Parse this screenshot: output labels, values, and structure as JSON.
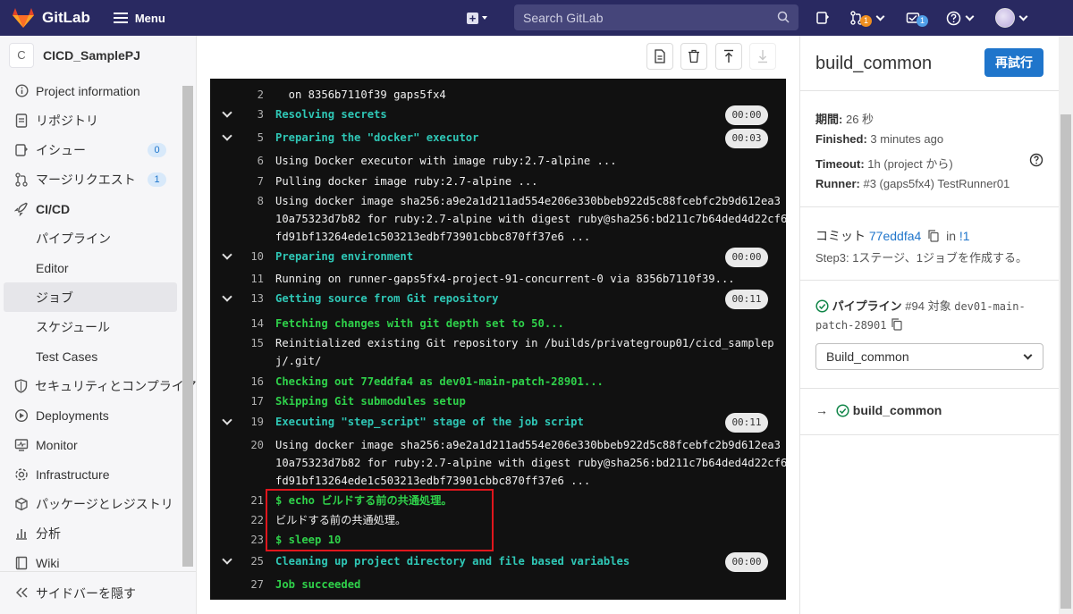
{
  "topbar": {
    "app_name": "GitLab",
    "menu_label": "Menu",
    "search_placeholder": "Search GitLab",
    "mr_count": "1",
    "todo_count": "1"
  },
  "sidebar": {
    "project_initial": "C",
    "project_name": "CICD_SamplePJ",
    "items": [
      {
        "label": "Project information",
        "icon": "info-icon"
      },
      {
        "label": "リポジトリ",
        "icon": "document-icon"
      },
      {
        "label": "イシュー",
        "icon": "issues-icon",
        "count": "0"
      },
      {
        "label": "マージリクエスト",
        "icon": "merge-request-icon",
        "count": "1"
      },
      {
        "label": "CI/CD",
        "icon": "rocket-icon"
      }
    ],
    "cicd_sub": [
      "パイプライン",
      "Editor",
      "ジョブ",
      "スケジュール",
      "Test Cases"
    ],
    "items2": [
      {
        "label": "セキュリティとコンプライアンス",
        "icon": "shield-icon"
      },
      {
        "label": "Deployments",
        "icon": "deployments-icon"
      },
      {
        "label": "Monitor",
        "icon": "monitor-icon"
      },
      {
        "label": "Infrastructure",
        "icon": "infrastructure-icon"
      },
      {
        "label": "パッケージとレジストリ",
        "icon": "package-icon"
      },
      {
        "label": "分析",
        "icon": "chart-icon"
      },
      {
        "label": "Wiki",
        "icon": "book-icon"
      }
    ],
    "collapse_label": "サイドバーを隠す"
  },
  "log": {
    "lines": [
      {
        "n": "2",
        "text": "  on 8356b7110f39 gaps5fx4",
        "style": "plain"
      },
      {
        "n": "3",
        "text": "Resolving secrets",
        "style": "teal",
        "section": true,
        "duration": "00:00"
      },
      {
        "n": "5",
        "text": "Preparing the \"docker\" executor",
        "style": "teal",
        "section": true,
        "duration": "00:03"
      },
      {
        "n": "6",
        "text": "Using Docker executor with image ruby:2.7-alpine ...",
        "style": "plain"
      },
      {
        "n": "7",
        "text": "Pulling docker image ruby:2.7-alpine ...",
        "style": "plain"
      },
      {
        "n": "8",
        "text": "Using docker image sha256:a9e2a1d211ad554e206e330bbeb922d5c88fcebfc2b9d612ea3\n10a75323d7b82 for ruby:2.7-alpine with digest ruby@sha256:bd211c7b64ded4d22cf6\nfd91bf13264ede1c503213edbf73901cbbc870ff37e6 ...",
        "style": "plain"
      },
      {
        "n": "10",
        "text": "Preparing environment",
        "style": "teal",
        "section": true,
        "duration": "00:00"
      },
      {
        "n": "11",
        "text": "Running on runner-gaps5fx4-project-91-concurrent-0 via 8356b7110f39...",
        "style": "plain"
      },
      {
        "n": "13",
        "text": "Getting source from Git repository",
        "style": "teal",
        "section": true,
        "duration": "00:11"
      },
      {
        "n": "14",
        "text": "Fetching changes with git depth set to 50...",
        "style": "green"
      },
      {
        "n": "15",
        "text": "Reinitialized existing Git repository in /builds/privategroup01/cicd_samplep\nj/.git/",
        "style": "plain"
      },
      {
        "n": "16",
        "text": "Checking out 77eddfa4 as dev01-main-patch-28901...",
        "style": "green"
      },
      {
        "n": "17",
        "text": "Skipping Git submodules setup",
        "style": "green"
      },
      {
        "n": "19",
        "text": "Executing \"step_script\" stage of the job script",
        "style": "teal",
        "section": true,
        "duration": "00:11"
      },
      {
        "n": "20",
        "text": "Using docker image sha256:a9e2a1d211ad554e206e330bbeb922d5c88fcebfc2b9d612ea3\n10a75323d7b82 for ruby:2.7-alpine with digest ruby@sha256:bd211c7b64ded4d22cf6\nfd91bf13264ede1c503213edbf73901cbbc870ff37e6 ...",
        "style": "plain"
      },
      {
        "n": "21",
        "text": "$ echo ビルドする前の共通処理。",
        "style": "green"
      },
      {
        "n": "22",
        "text": "ビルドする前の共通処理。",
        "style": "plain"
      },
      {
        "n": "23",
        "text": "$ sleep 10",
        "style": "green"
      },
      {
        "n": "25",
        "text": "Cleaning up project directory and file based variables",
        "style": "teal",
        "section": true,
        "duration": "00:00"
      },
      {
        "n": "27",
        "text": "Job succeeded",
        "style": "green"
      }
    ]
  },
  "panel": {
    "job_name": "build_common",
    "retry_label": "再試行",
    "duration_label": "期間:",
    "duration_value": "26 秒",
    "finished_label": "Finished:",
    "finished_value": "3 minutes ago",
    "timeout_label": "Timeout:",
    "timeout_value": "1h (project から)",
    "runner_label": "Runner:",
    "runner_value": "#3 (gaps5fx4) TestRunner01",
    "commit_label": "コミット",
    "commit_sha": "77eddfa4",
    "commit_in": "in",
    "commit_mr": "!1",
    "commit_message": "Step3: 1ステージ、1ジョブを作成する。",
    "pipeline_label": "パイプライン",
    "pipeline_id": "#94",
    "pipeline_for": "対象",
    "pipeline_branch_1": "dev01-main-",
    "pipeline_branch_2": "patch-28901",
    "stage_select": "Build_common",
    "job_link": "build_common"
  }
}
